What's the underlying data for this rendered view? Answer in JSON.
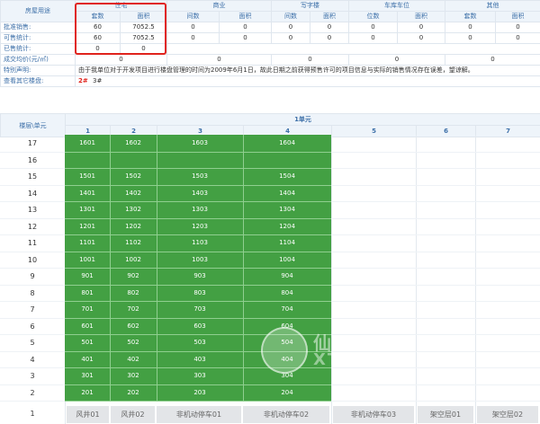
{
  "summary": {
    "header_label": "房屋用途",
    "groups": [
      "住宅",
      "商业",
      "写字楼",
      "车库车位",
      "其他"
    ],
    "sub_headers": [
      [
        "套数",
        "面积"
      ],
      [
        "间数",
        "面积"
      ],
      [
        "间数",
        "面积"
      ],
      [
        "位数",
        "面积"
      ],
      [
        "套数",
        "面积"
      ]
    ],
    "rows": [
      {
        "label": "批准销售:",
        "values": [
          "60",
          "7052.5",
          "0",
          "0",
          "0",
          "0",
          "0",
          "0",
          "0",
          "0"
        ]
      },
      {
        "label": "可售统计:",
        "values": [
          "60",
          "7052.5",
          "0",
          "0",
          "0",
          "0",
          "0",
          "0",
          "0",
          "0"
        ]
      },
      {
        "label": "已售统计:",
        "values": [
          "0",
          "0",
          "",
          "",
          "",
          "",
          "",
          "",
          "",
          ""
        ]
      }
    ],
    "avg_price_label": "成交均价(元/㎡)",
    "avg_price_values": [
      "0",
      "0",
      "0",
      "0",
      "0"
    ],
    "notice_label": "特别声明:",
    "notice_text": "由于我单位对于开发项目进行楼盘管理的时间为2009年6月1日，故此日期之前获得预售许可的项目信息与实际的销售情况存在误差，望谅解。",
    "other_label": "查看其它楼盘:",
    "other_current": "2#",
    "other_link": "3#"
  },
  "building": {
    "corner_label": "楼层\\单元",
    "unit_label": "1单元",
    "columns": [
      "1",
      "2",
      "3",
      "4",
      "5",
      "6",
      "7"
    ],
    "floors": [
      {
        "floor": "17",
        "rooms": [
          "1601",
          "1602",
          "1603",
          "1604"
        ]
      },
      {
        "floor": "16",
        "rooms": [
          "",
          "",
          "",
          ""
        ]
      },
      {
        "floor": "15",
        "rooms": [
          "1501",
          "1502",
          "1503",
          "1504"
        ]
      },
      {
        "floor": "14",
        "rooms": [
          "1401",
          "1402",
          "1403",
          "1404"
        ]
      },
      {
        "floor": "13",
        "rooms": [
          "1301",
          "1302",
          "1303",
          "1304"
        ]
      },
      {
        "floor": "12",
        "rooms": [
          "1201",
          "1202",
          "1203",
          "1204"
        ]
      },
      {
        "floor": "11",
        "rooms": [
          "1101",
          "1102",
          "1103",
          "1104"
        ]
      },
      {
        "floor": "10",
        "rooms": [
          "1001",
          "1002",
          "1003",
          "1004"
        ]
      },
      {
        "floor": "9",
        "rooms": [
          "901",
          "902",
          "903",
          "904"
        ]
      },
      {
        "floor": "8",
        "rooms": [
          "801",
          "802",
          "803",
          "804"
        ]
      },
      {
        "floor": "7",
        "rooms": [
          "701",
          "702",
          "703",
          "704"
        ]
      },
      {
        "floor": "6",
        "rooms": [
          "601",
          "602",
          "603",
          "604"
        ]
      },
      {
        "floor": "5",
        "rooms": [
          "501",
          "502",
          "503",
          "504"
        ]
      },
      {
        "floor": "4",
        "rooms": [
          "401",
          "402",
          "403",
          "404"
        ]
      },
      {
        "floor": "3",
        "rooms": [
          "301",
          "302",
          "303",
          "304"
        ]
      },
      {
        "floor": "2",
        "rooms": [
          "201",
          "202",
          "203",
          "204"
        ]
      }
    ],
    "bottom_floor": "1",
    "bottom_cells": [
      "风井01",
      "风井02",
      "非机动停车01",
      "非机动停车02",
      "非机动停车03",
      "架空层01",
      "架空层02"
    ],
    "available_color": "#43a043"
  },
  "watermark": {
    "line1": "仙",
    "line2": "XT"
  }
}
